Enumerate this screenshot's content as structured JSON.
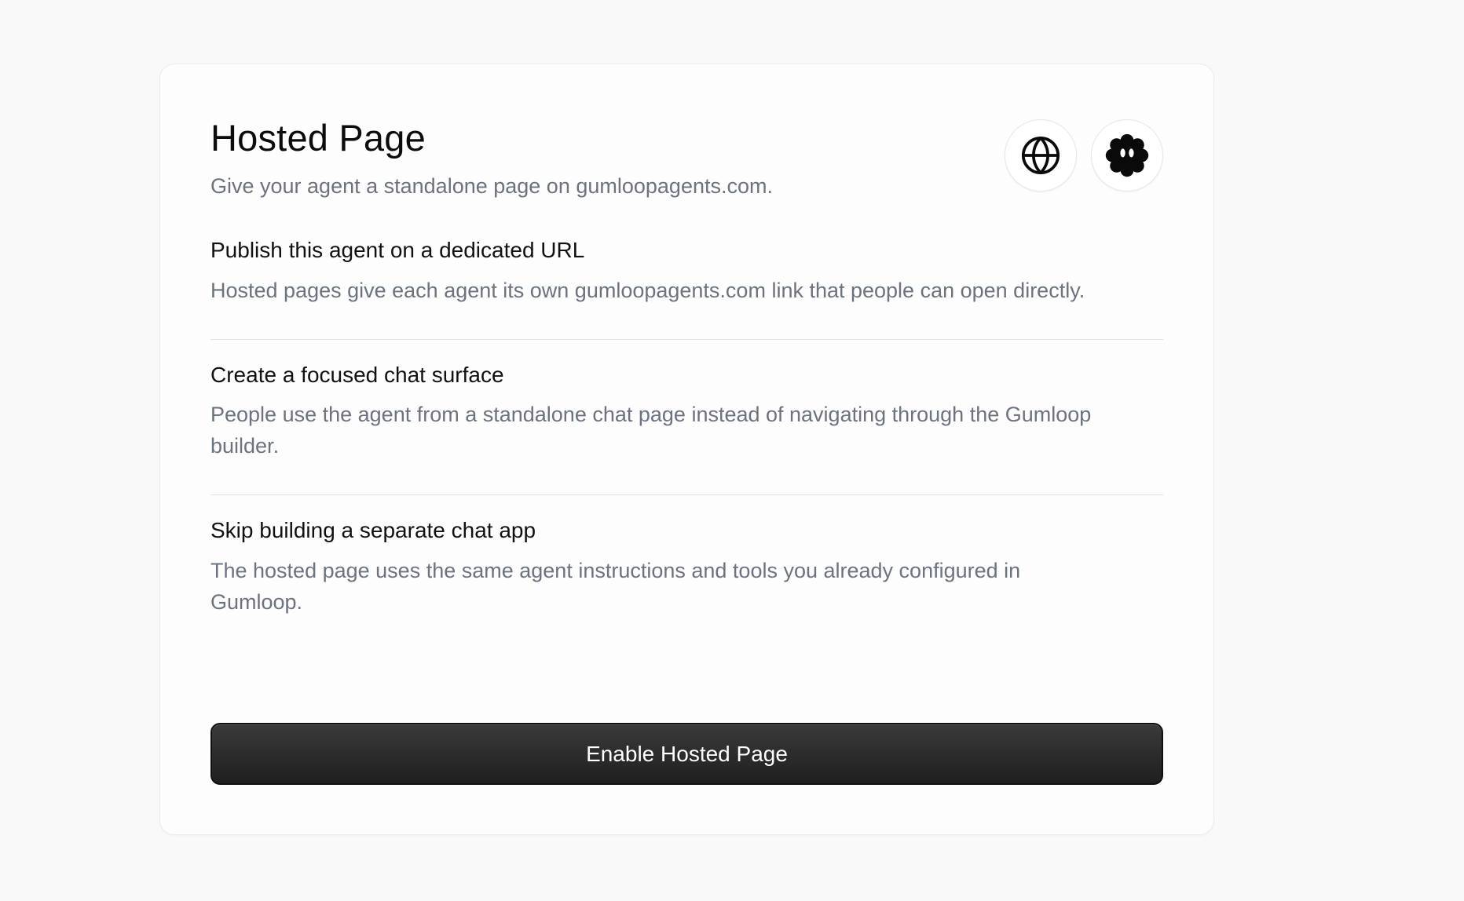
{
  "card": {
    "title": "Hosted Page",
    "subtitle": "Give your agent a standalone page on gumloopagents.com.",
    "icons": [
      "globe-icon",
      "gumloop-agent-icon"
    ]
  },
  "sections": [
    {
      "title": "Publish this agent on a dedicated URL",
      "description": "Hosted pages give each agent its own gumloopagents.com link that people can open directly."
    },
    {
      "title": "Create a focused chat surface",
      "description": "People use the agent from a standalone chat page instead of navigating through the Gumloop builder."
    },
    {
      "title": "Skip building a separate chat app",
      "description": "The hosted page uses the same agent instructions and tools you already configured in Gumloop."
    }
  ],
  "actions": {
    "enable_label": "Enable Hosted Page"
  },
  "colors": {
    "background": "#f9f9f9",
    "card": "#fdfdfd",
    "muted_text": "#6b7280",
    "button": "#262626"
  }
}
